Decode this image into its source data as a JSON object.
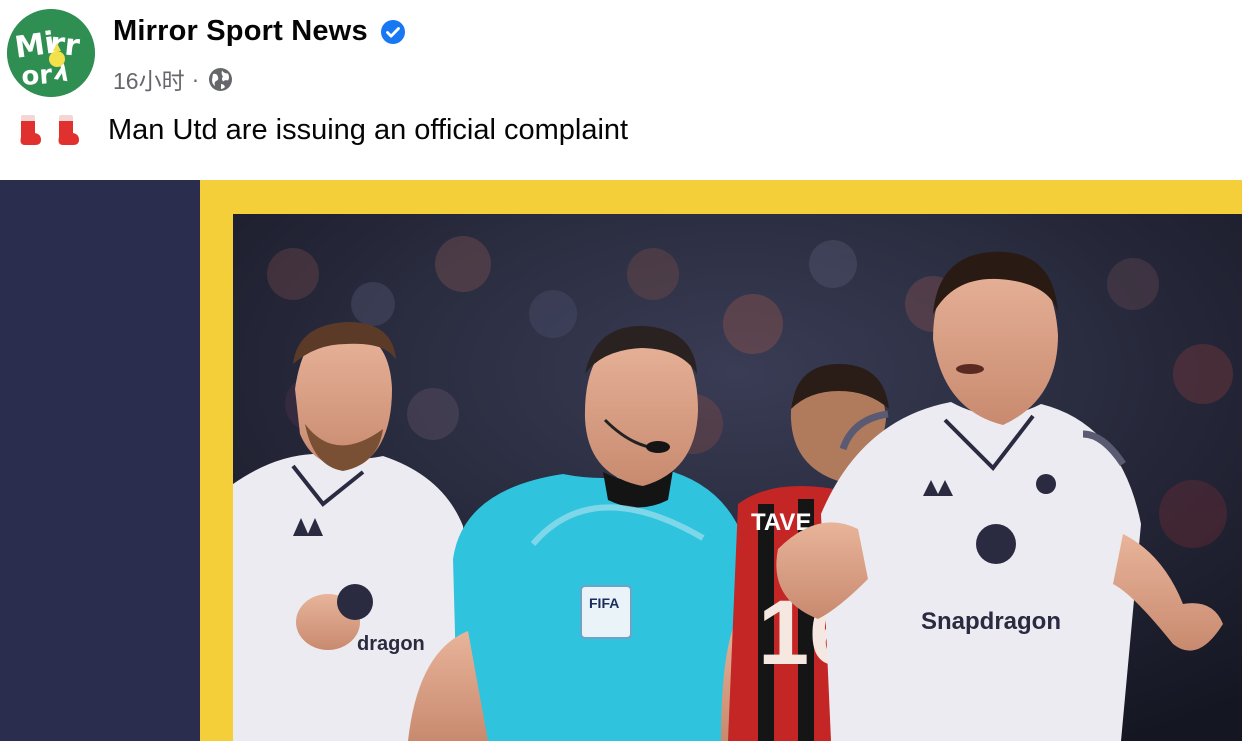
{
  "post": {
    "page_name": "Mirror Sport News",
    "timestamp": "16小时",
    "separator": "·",
    "text": "Man Utd are issuing an official complaint",
    "icons": {
      "avatar": "mirror-sport-logo",
      "verified": "verified-badge-icon",
      "audience": "globe-icon",
      "emoji": "red-sock-emoji"
    }
  },
  "photo": {
    "shirt_texts": {
      "sponsor_right": "Snapdragon",
      "sponsor_left": "dragon",
      "badge_fifa": "FIFA",
      "opponent_name": "TAVE",
      "opponent_number": "16"
    }
  },
  "colors": {
    "verified": "#1877f2",
    "avatar_bg": "#2f8f52",
    "frame_yellow": "#f4cf3a",
    "strip_navy": "#2b2d4e",
    "referee_shirt": "#2fc3de",
    "opponent_red": "#d42a2a"
  }
}
